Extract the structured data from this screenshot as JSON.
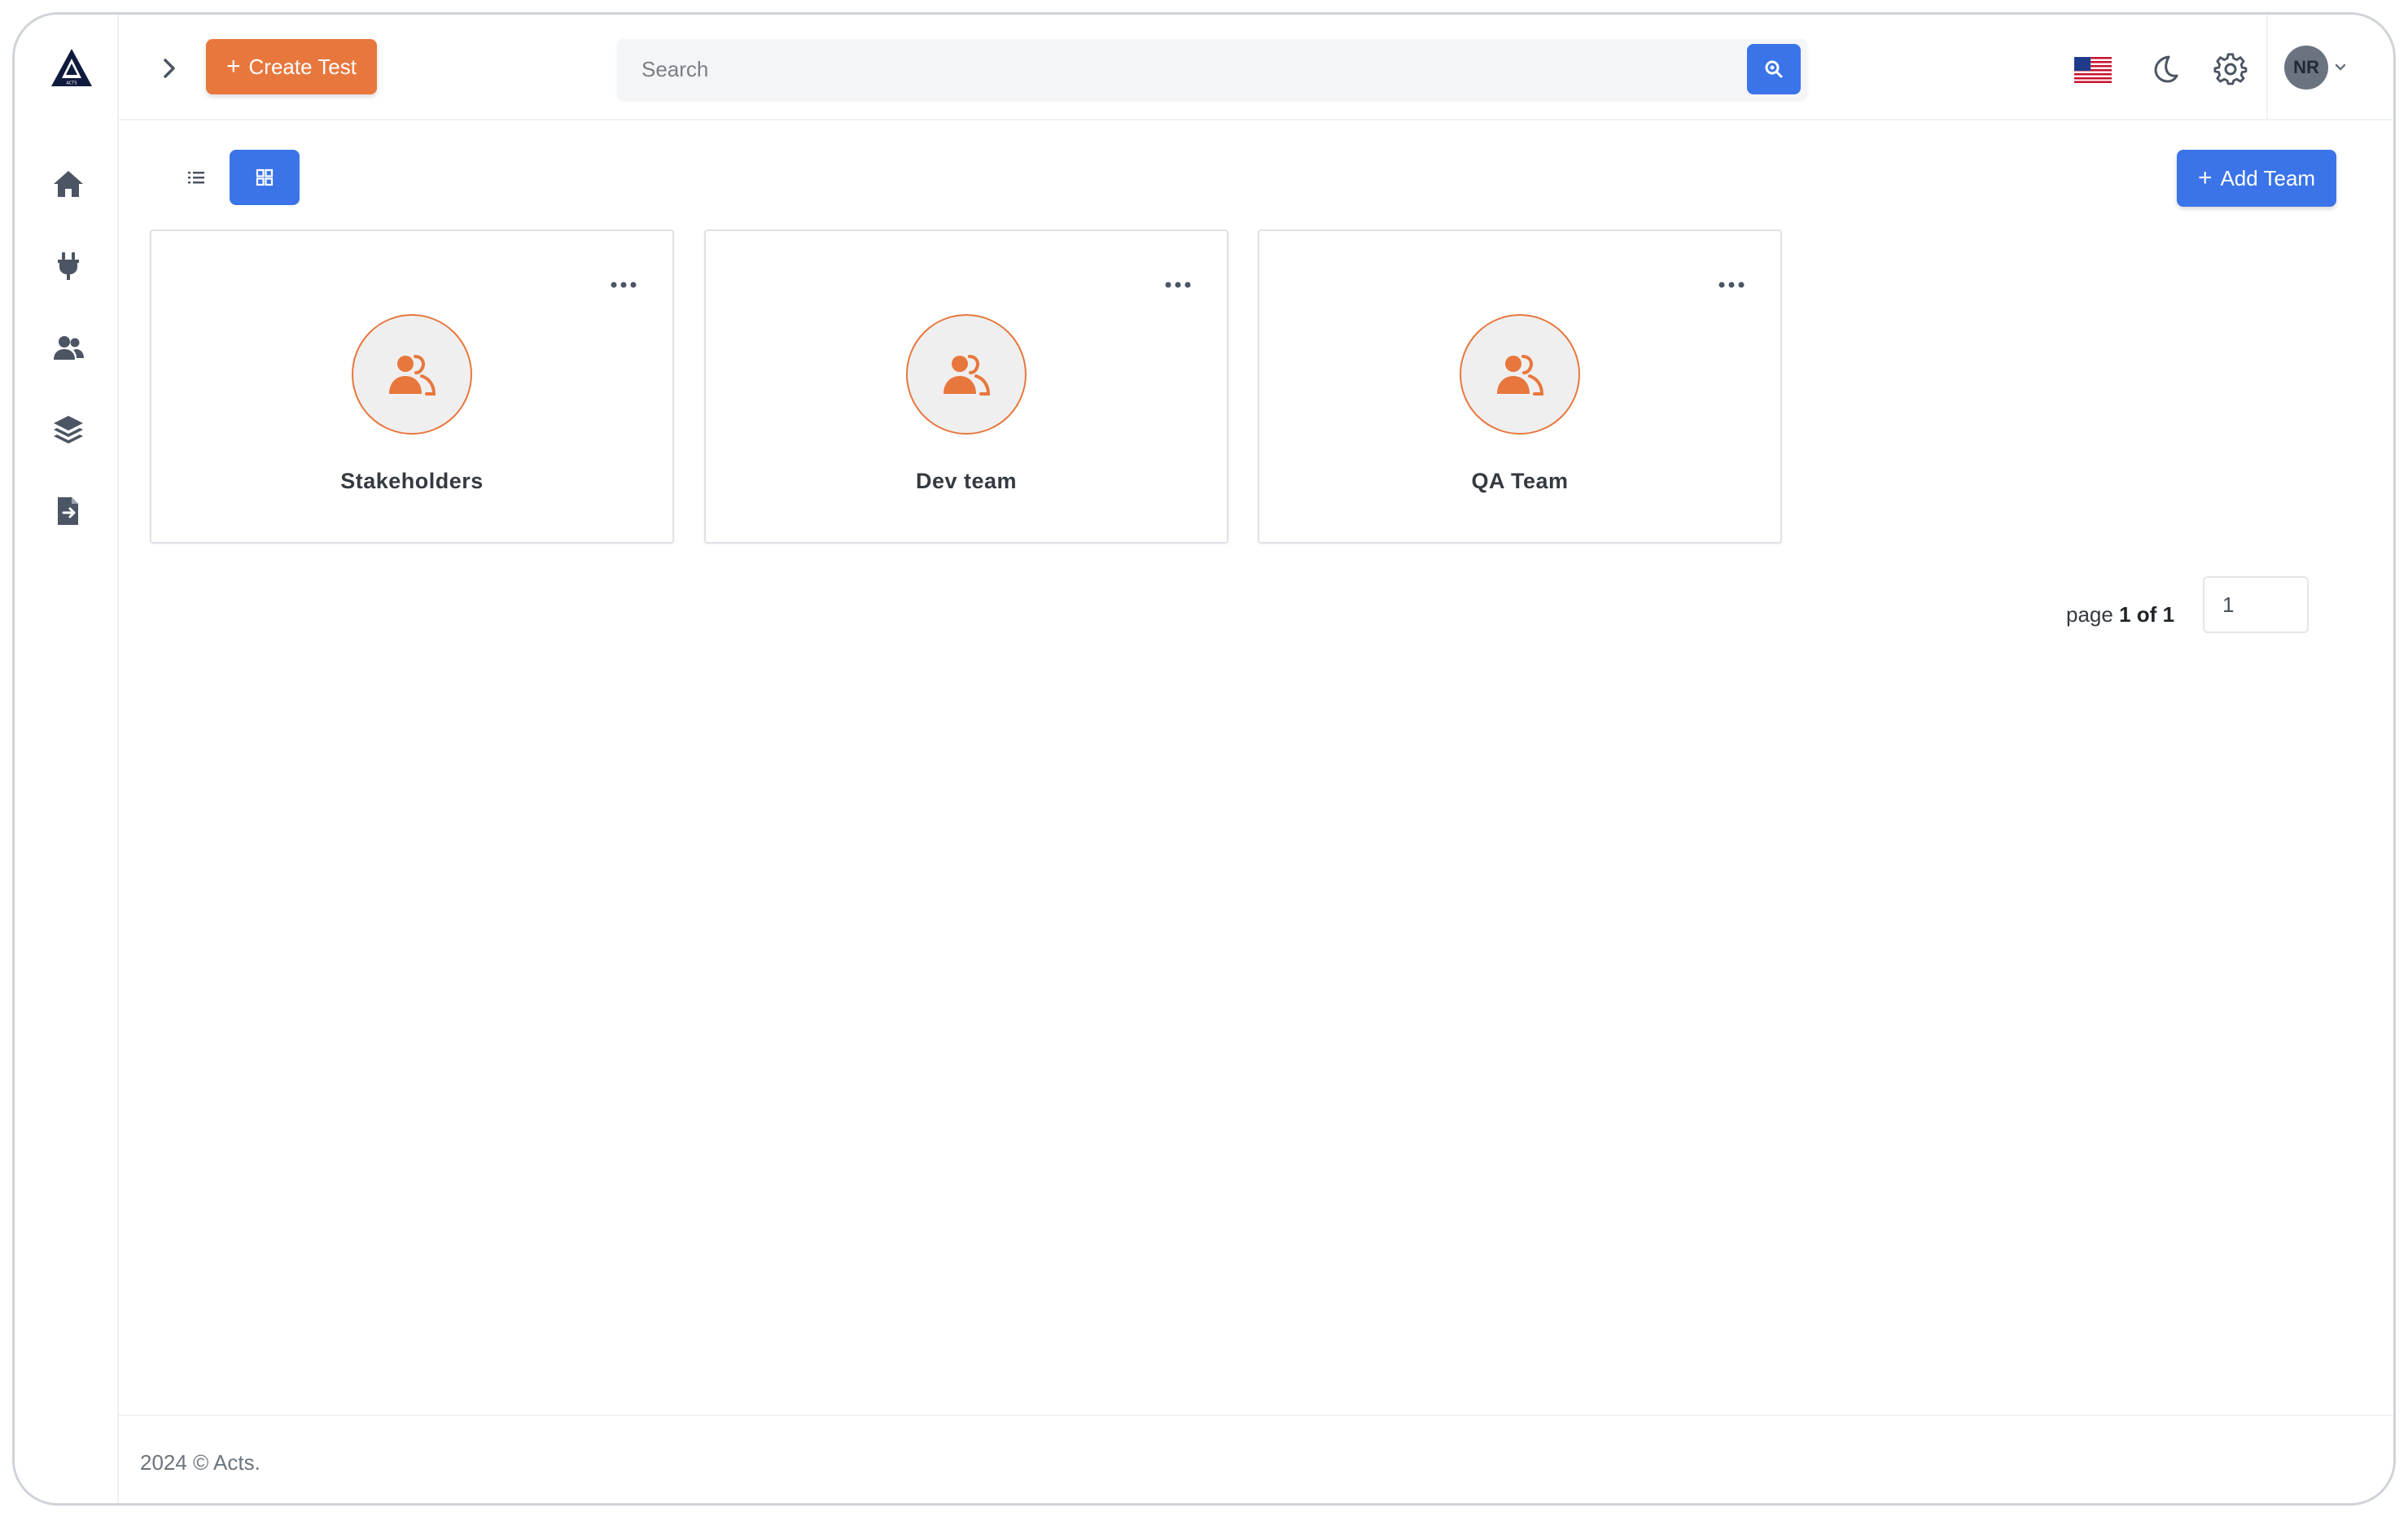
{
  "header": {
    "create_test_label": "Create Test",
    "search_placeholder": "Search",
    "language": "en-US",
    "avatar_initials": "NR"
  },
  "sidebar": {
    "items": [
      {
        "icon": "home-icon"
      },
      {
        "icon": "plug-icon"
      },
      {
        "icon": "users-icon"
      },
      {
        "icon": "layers-icon"
      },
      {
        "icon": "file-export-icon"
      }
    ]
  },
  "toolbar": {
    "active_view": "grid",
    "add_team_label": "Add Team"
  },
  "teams": [
    {
      "name": "Stakeholders"
    },
    {
      "name": "Dev team"
    },
    {
      "name": "QA Team"
    }
  ],
  "pagination": {
    "prefix": "page",
    "current": "1",
    "of_text": "of",
    "total": "1",
    "input_value": "1"
  },
  "footer": {
    "text": "2024 © Acts."
  },
  "colors": {
    "primary": "#3b74e8",
    "accent": "#e8773d"
  }
}
